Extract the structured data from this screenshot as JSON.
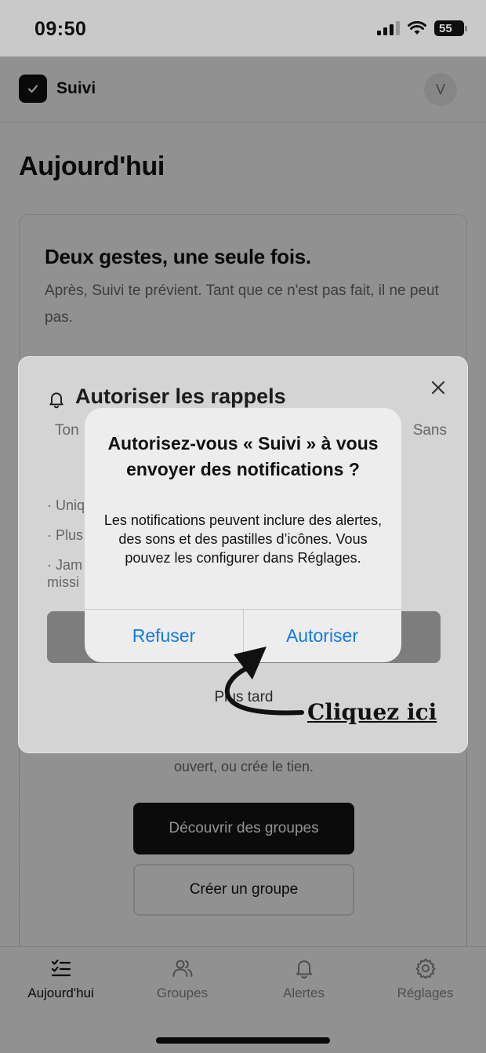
{
  "status_bar": {
    "time": "09:50",
    "battery": "55"
  },
  "header": {
    "app_name": "Suivi",
    "avatar_initial": "V"
  },
  "page": {
    "title": "Aujourd'hui"
  },
  "card": {
    "title": "Deux gestes, une seule fois.",
    "description": "Après, Suivi te prévient. Tant que ce n'est pas fait, il ne peut pas."
  },
  "groups": {
    "text": "ouvert, ou crée le tien.",
    "discover_label": "Découvrir des groupes",
    "create_label": "Créer un groupe"
  },
  "modal": {
    "title": "Autoriser les rappels",
    "body_start": "Ton",
    "body_end": "Sans",
    "bullets": [
      "· Uniq",
      "· Plus",
      "· Jam",
      "missi"
    ],
    "later_label": "Plus tard"
  },
  "alert": {
    "title": "Autorisez-vous « Suivi » à vous envoyer des notifications ?",
    "message": "Les notifications peuvent inclure des alertes, des sons et des pastilles d’icônes. Vous pouvez les configurer dans Réglages.",
    "deny_label": "Refuser",
    "allow_label": "Autoriser",
    "button_color": "#1479e6"
  },
  "annotation": {
    "text": "Cliquez ici"
  },
  "tabs": [
    {
      "label": "Aujourd'hui",
      "icon": "checklist-icon",
      "active": true
    },
    {
      "label": "Groupes",
      "icon": "users-icon",
      "active": false
    },
    {
      "label": "Alertes",
      "icon": "bell-icon",
      "active": false
    },
    {
      "label": "Réglages",
      "icon": "gear-icon",
      "active": false
    }
  ]
}
